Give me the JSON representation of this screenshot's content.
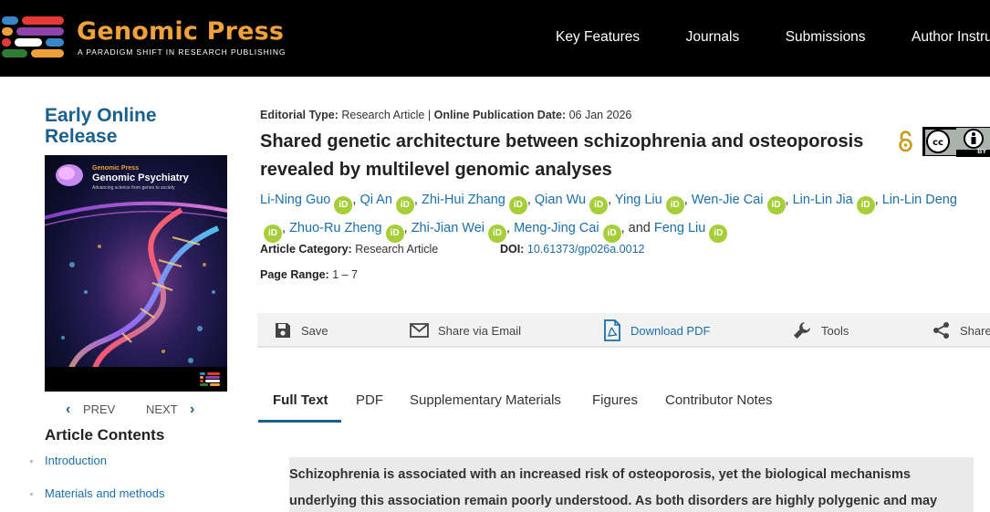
{
  "header": {
    "logo_title": "Genomic Press",
    "logo_subtitle": "A PARADIGM SHIFT IN RESEARCH PUBLISHING",
    "nav": [
      "Key Features",
      "Journals",
      "Submissions",
      "Author Instruct"
    ]
  },
  "sidebar": {
    "section_title_line1": "Early Online",
    "section_title_line2": "Release",
    "cover": {
      "brand": "Genomic Press",
      "title": "Genomic Psychiatry",
      "tagline": "Advancing science from genes to society"
    },
    "prev_label": "PREV",
    "next_label": "NEXT",
    "contents_title": "Article Contents",
    "contents": [
      "Introduction",
      "Materials and methods"
    ]
  },
  "article": {
    "editorial_type_label": "Editorial Type:",
    "editorial_type": "Research Article",
    "divider": "|",
    "pub_date_label": "Online Publication Date:",
    "pub_date": "06 Jan 2026",
    "title": "Shared genetic architecture between schizophrenia and osteoporosis revealed by multilevel genomic analyses",
    "orcid_glyph": "iD",
    "and_word": "and",
    "authors": [
      "Li-Ning Guo",
      "Qi An",
      "Zhi-Hui Zhang",
      "Qian Wu",
      "Ying Liu",
      "Wen-Jie Cai",
      "Lin-Lin Jia",
      "Lin-Lin Deng",
      "Zhuo-Ru Zheng",
      "Zhi-Jian Wei",
      "Meng-Jing Cai",
      "Feng Liu"
    ],
    "category_label": "Article Category:",
    "category": "Research Article",
    "doi_label": "DOI:",
    "doi": "10.61373/gp026a.0012",
    "page_range_label": "Page Range:",
    "page_range": "1 – 7",
    "license_text": "BY"
  },
  "toolbar": {
    "save": "Save",
    "share_email": "Share via Email",
    "download_pdf": "Download PDF",
    "tools": "Tools",
    "share": "Share"
  },
  "tabs": [
    "Full Text",
    "PDF",
    "Supplementary Materials",
    "Figures",
    "Contributor Notes"
  ],
  "abstract": {
    "line1": "Schizophrenia is associated with an increased risk of osteoporosis, yet the biological mechanisms",
    "line2": "underlying this association remain poorly understood. As both disorders are highly polygenic and may"
  },
  "colors": {
    "brand_orange": "#f0a23a",
    "link_blue": "#1b6fa6",
    "heading_blue": "#1b5f8c",
    "orcid_green": "#a6ce39",
    "open_access": "#c99a17"
  }
}
